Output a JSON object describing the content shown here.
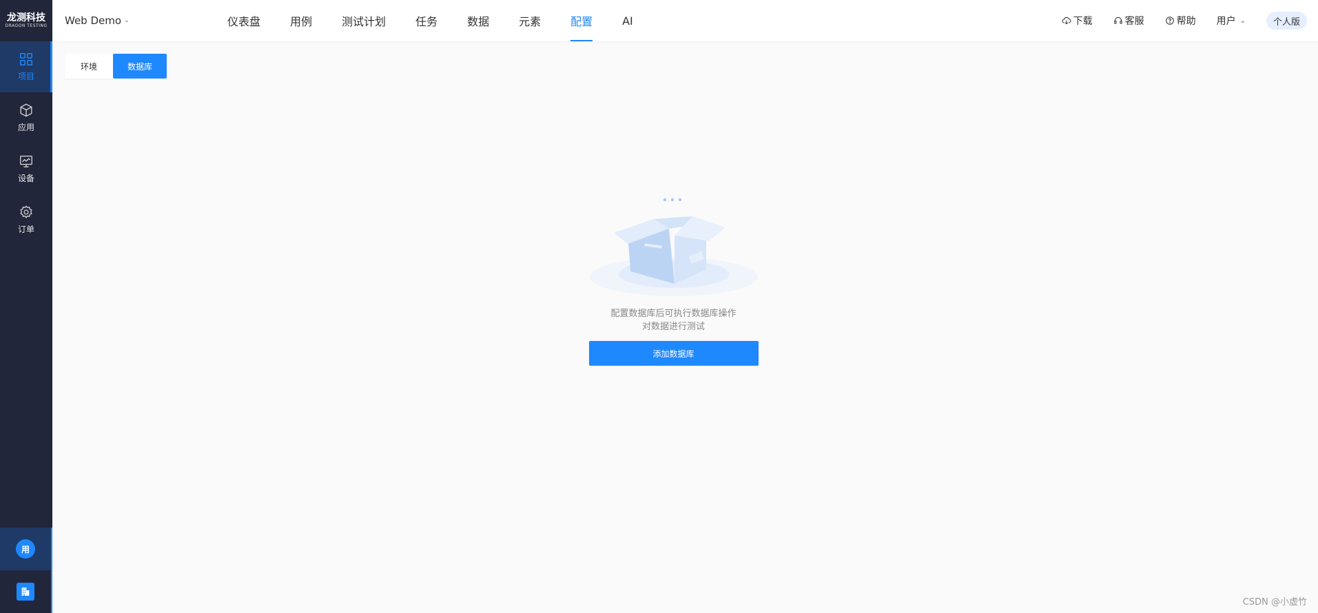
{
  "logo": {
    "main": "龙测科技",
    "sub": "DRAGON TESTING"
  },
  "sidebar": {
    "items": [
      {
        "label": "项目",
        "icon": "grid-icon",
        "active": true
      },
      {
        "label": "应用",
        "icon": "cube-icon",
        "active": false
      },
      {
        "label": "设备",
        "icon": "monitor-icon",
        "active": false
      },
      {
        "label": "订单",
        "icon": "gear-icon",
        "active": false
      }
    ],
    "user_avatar": "用",
    "org_icon": "building-icon"
  },
  "header": {
    "project": "Web Demo",
    "nav": [
      "仪表盘",
      "用例",
      "测试计划",
      "任务",
      "数据",
      "元素",
      "配置",
      "AI"
    ],
    "active_nav": "配置",
    "tools": {
      "download": "下载",
      "service": "客服",
      "help": "帮助",
      "user": "用户"
    },
    "plan": "个人版"
  },
  "tabs": [
    "环境",
    "数据库"
  ],
  "active_tab": "数据库",
  "empty": {
    "line1": "配置数据库后可执行数据库操作",
    "line2": "对数据进行测试",
    "button": "添加数据库"
  },
  "watermark": "CSDN @小虚竹",
  "colors": {
    "accent": "#1e88ff",
    "sidebar": "#22263a",
    "sidebar_active": "#1f3a66"
  }
}
